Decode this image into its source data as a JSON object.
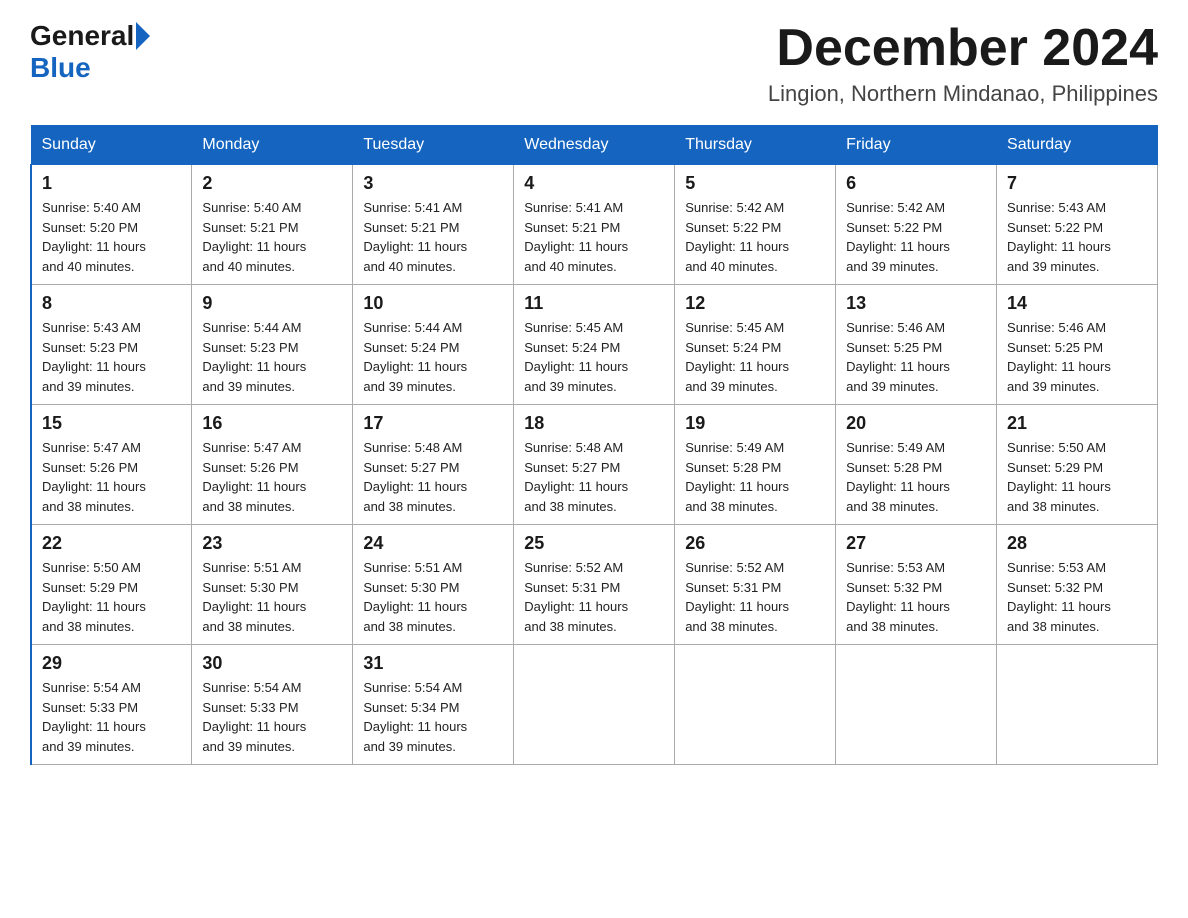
{
  "header": {
    "logo_general": "General",
    "logo_blue": "Blue",
    "month_title": "December 2024",
    "location": "Lingion, Northern Mindanao, Philippines"
  },
  "days_of_week": [
    "Sunday",
    "Monday",
    "Tuesday",
    "Wednesday",
    "Thursday",
    "Friday",
    "Saturday"
  ],
  "weeks": [
    [
      {
        "day": "1",
        "sunrise": "5:40 AM",
        "sunset": "5:20 PM",
        "daylight": "11 hours and 40 minutes."
      },
      {
        "day": "2",
        "sunrise": "5:40 AM",
        "sunset": "5:21 PM",
        "daylight": "11 hours and 40 minutes."
      },
      {
        "day": "3",
        "sunrise": "5:41 AM",
        "sunset": "5:21 PM",
        "daylight": "11 hours and 40 minutes."
      },
      {
        "day": "4",
        "sunrise": "5:41 AM",
        "sunset": "5:21 PM",
        "daylight": "11 hours and 40 minutes."
      },
      {
        "day": "5",
        "sunrise": "5:42 AM",
        "sunset": "5:22 PM",
        "daylight": "11 hours and 40 minutes."
      },
      {
        "day": "6",
        "sunrise": "5:42 AM",
        "sunset": "5:22 PM",
        "daylight": "11 hours and 39 minutes."
      },
      {
        "day": "7",
        "sunrise": "5:43 AM",
        "sunset": "5:22 PM",
        "daylight": "11 hours and 39 minutes."
      }
    ],
    [
      {
        "day": "8",
        "sunrise": "5:43 AM",
        "sunset": "5:23 PM",
        "daylight": "11 hours and 39 minutes."
      },
      {
        "day": "9",
        "sunrise": "5:44 AM",
        "sunset": "5:23 PM",
        "daylight": "11 hours and 39 minutes."
      },
      {
        "day": "10",
        "sunrise": "5:44 AM",
        "sunset": "5:24 PM",
        "daylight": "11 hours and 39 minutes."
      },
      {
        "day": "11",
        "sunrise": "5:45 AM",
        "sunset": "5:24 PM",
        "daylight": "11 hours and 39 minutes."
      },
      {
        "day": "12",
        "sunrise": "5:45 AM",
        "sunset": "5:24 PM",
        "daylight": "11 hours and 39 minutes."
      },
      {
        "day": "13",
        "sunrise": "5:46 AM",
        "sunset": "5:25 PM",
        "daylight": "11 hours and 39 minutes."
      },
      {
        "day": "14",
        "sunrise": "5:46 AM",
        "sunset": "5:25 PM",
        "daylight": "11 hours and 39 minutes."
      }
    ],
    [
      {
        "day": "15",
        "sunrise": "5:47 AM",
        "sunset": "5:26 PM",
        "daylight": "11 hours and 38 minutes."
      },
      {
        "day": "16",
        "sunrise": "5:47 AM",
        "sunset": "5:26 PM",
        "daylight": "11 hours and 38 minutes."
      },
      {
        "day": "17",
        "sunrise": "5:48 AM",
        "sunset": "5:27 PM",
        "daylight": "11 hours and 38 minutes."
      },
      {
        "day": "18",
        "sunrise": "5:48 AM",
        "sunset": "5:27 PM",
        "daylight": "11 hours and 38 minutes."
      },
      {
        "day": "19",
        "sunrise": "5:49 AM",
        "sunset": "5:28 PM",
        "daylight": "11 hours and 38 minutes."
      },
      {
        "day": "20",
        "sunrise": "5:49 AM",
        "sunset": "5:28 PM",
        "daylight": "11 hours and 38 minutes."
      },
      {
        "day": "21",
        "sunrise": "5:50 AM",
        "sunset": "5:29 PM",
        "daylight": "11 hours and 38 minutes."
      }
    ],
    [
      {
        "day": "22",
        "sunrise": "5:50 AM",
        "sunset": "5:29 PM",
        "daylight": "11 hours and 38 minutes."
      },
      {
        "day": "23",
        "sunrise": "5:51 AM",
        "sunset": "5:30 PM",
        "daylight": "11 hours and 38 minutes."
      },
      {
        "day": "24",
        "sunrise": "5:51 AM",
        "sunset": "5:30 PM",
        "daylight": "11 hours and 38 minutes."
      },
      {
        "day": "25",
        "sunrise": "5:52 AM",
        "sunset": "5:31 PM",
        "daylight": "11 hours and 38 minutes."
      },
      {
        "day": "26",
        "sunrise": "5:52 AM",
        "sunset": "5:31 PM",
        "daylight": "11 hours and 38 minutes."
      },
      {
        "day": "27",
        "sunrise": "5:53 AM",
        "sunset": "5:32 PM",
        "daylight": "11 hours and 38 minutes."
      },
      {
        "day": "28",
        "sunrise": "5:53 AM",
        "sunset": "5:32 PM",
        "daylight": "11 hours and 38 minutes."
      }
    ],
    [
      {
        "day": "29",
        "sunrise": "5:54 AM",
        "sunset": "5:33 PM",
        "daylight": "11 hours and 39 minutes."
      },
      {
        "day": "30",
        "sunrise": "5:54 AM",
        "sunset": "5:33 PM",
        "daylight": "11 hours and 39 minutes."
      },
      {
        "day": "31",
        "sunrise": "5:54 AM",
        "sunset": "5:34 PM",
        "daylight": "11 hours and 39 minutes."
      },
      null,
      null,
      null,
      null
    ]
  ],
  "labels": {
    "sunrise": "Sunrise:",
    "sunset": "Sunset:",
    "daylight": "Daylight:"
  }
}
